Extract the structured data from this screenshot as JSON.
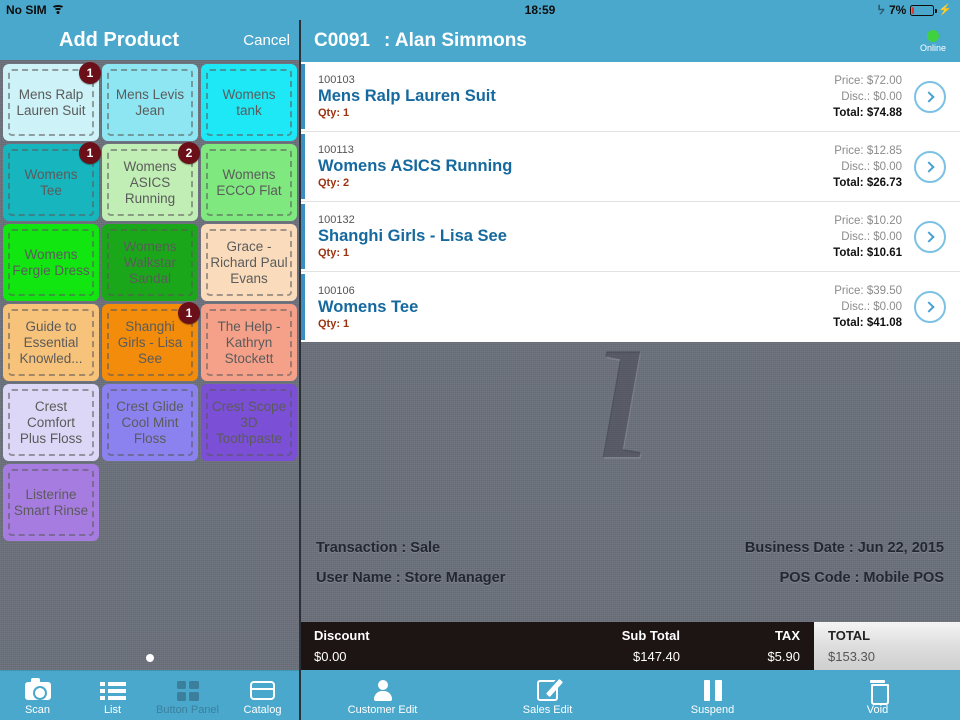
{
  "left": {
    "status": {
      "carrier": "No SIM",
      "wifi_icon": "wifi-icon"
    },
    "nav": {
      "title": "Add Product",
      "cancel_label": "Cancel"
    },
    "tiles": [
      {
        "label": "Mens Ralp Lauren Suit",
        "color": "#cdf2f7",
        "badge": "1"
      },
      {
        "label": "Mens Levis Jean",
        "color": "#8ee6f2",
        "badge": ""
      },
      {
        "label": "Womens tank",
        "color": "#1ee8f5",
        "badge": ""
      },
      {
        "label": "Womens Tee",
        "color": "#17b5bd",
        "badge": "1"
      },
      {
        "label": "Womens ASICS Running",
        "color": "#c0eeb4",
        "badge": "2"
      },
      {
        "label": "Womens ECCO Flat",
        "color": "#7fe87f",
        "badge": ""
      },
      {
        "label": "Womens Fergie Dress",
        "color": "#11e611",
        "badge": ""
      },
      {
        "label": "Womens Walkstar Sandal",
        "color": "#1aa81a",
        "badge": ""
      },
      {
        "label": "Grace - Richard Paul Evans",
        "color": "#fadcbc",
        "badge": ""
      },
      {
        "label": "Guide to Essential Knowled...",
        "color": "#f7c27a",
        "badge": ""
      },
      {
        "label": "Shanghi Girls - Lisa See",
        "color": "#f28c0a",
        "badge": "1"
      },
      {
        "label": "The Help - Kathryn Stockett",
        "color": "#f5a089",
        "badge": ""
      },
      {
        "label": "Crest Comfort Plus Floss",
        "color": "#ddd7f7",
        "badge": ""
      },
      {
        "label": "Crest Glide Cool Mint Floss",
        "color": "#8b82f0",
        "badge": ""
      },
      {
        "label": "Crest Scope 3D Toothpaste",
        "color": "#7b4fd6",
        "badge": ""
      },
      {
        "label": "Listerine Smart Rinse",
        "color": "#a77ce0",
        "badge": ""
      }
    ],
    "tabs": [
      {
        "label": "Scan",
        "icon": "camera-icon",
        "selected": false
      },
      {
        "label": "List",
        "icon": "list-icon",
        "selected": false
      },
      {
        "label": "Button Panel",
        "icon": "grid-icon",
        "selected": true
      },
      {
        "label": "Catalog",
        "icon": "catalog-icon",
        "selected": false
      }
    ]
  },
  "right": {
    "status": {
      "time": "18:59",
      "bluetooth_icon": "bluetooth-icon",
      "battery_pct": "7%",
      "battery_level": 7,
      "charging_icon": "lightning-bolt-icon"
    },
    "nav": {
      "customer_id": "C0091",
      "customer_name": ": Alan Simmons",
      "online_label": "Online",
      "online_color": "#3fd13f"
    },
    "cart_items": [
      {
        "sku": "100103",
        "name": "Mens Ralp Lauren Suit",
        "qty": "Qty: 1",
        "price": "Price: $72.00",
        "disc": "Disc.: $0.00",
        "total": "Total: $74.88"
      },
      {
        "sku": "100113",
        "name": "Womens ASICS Running",
        "qty": "Qty: 2",
        "price": "Price: $12.85",
        "disc": "Disc.: $0.00",
        "total": "Total: $26.73"
      },
      {
        "sku": "100132",
        "name": "Shanghi Girls - Lisa See",
        "qty": "Qty: 1",
        "price": "Price: $10.20",
        "disc": "Disc.: $0.00",
        "total": "Total: $10.61"
      },
      {
        "sku": "100106",
        "name": "Womens Tee",
        "qty": "Qty: 1",
        "price": "Price: $39.50",
        "disc": "Disc.: $0.00",
        "total": "Total: $41.08"
      }
    ],
    "meta": {
      "transaction": "Transaction : Sale",
      "business_date": "Business Date : Jun 22, 2015",
      "user_name": "User Name : Store Manager",
      "pos_code": "POS Code : Mobile POS"
    },
    "totals": {
      "discount_label": "Discount",
      "discount_value": "$0.00",
      "subtotal_label": "Sub Total",
      "subtotal_value": "$147.40",
      "tax_label": "TAX",
      "tax_value": "$5.90",
      "total_label": "TOTAL",
      "total_value": "$153.30"
    },
    "tabs": [
      {
        "label": "Customer Edit",
        "icon": "person-icon"
      },
      {
        "label": "Sales Edit",
        "icon": "pencil-edit-icon"
      },
      {
        "label": "Suspend",
        "icon": "pause-icon"
      },
      {
        "label": "Void",
        "icon": "trash-icon"
      }
    ]
  }
}
